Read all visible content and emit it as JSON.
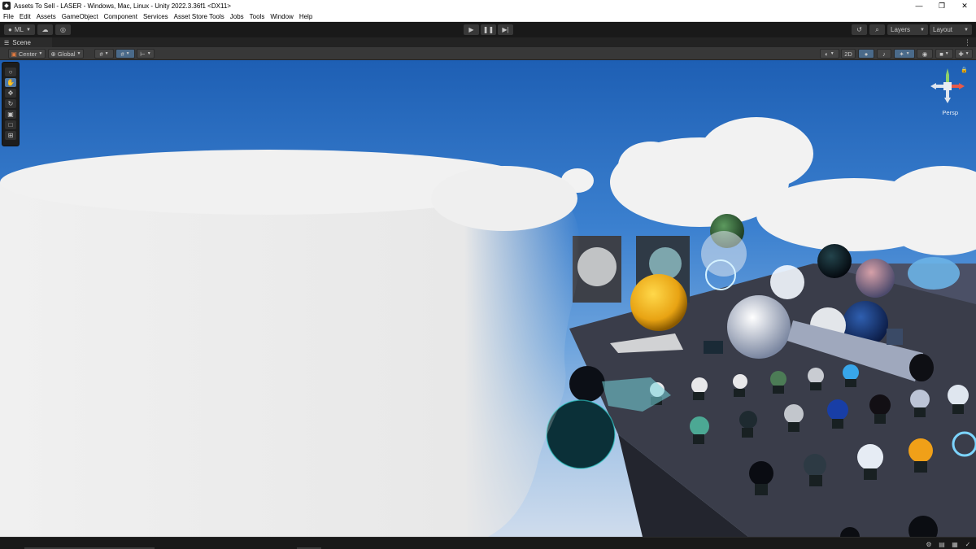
{
  "window": {
    "title": "Assets To Sell - LASER - Windows, Mac, Linux - Unity 2022.3.36f1 <DX11>",
    "minimize": "—",
    "maximize": "❐",
    "close": "✕"
  },
  "menu": [
    "File",
    "Edit",
    "Assets",
    "GameObject",
    "Component",
    "Services",
    "Asset Store Tools",
    "Jobs",
    "Tools",
    "Window",
    "Help"
  ],
  "toolbar": {
    "account_label": "ML",
    "layers_label": "Layers",
    "layout_label": "Layout"
  },
  "scene_tab": {
    "label": "Scene"
  },
  "scene_toolbar": {
    "pivot_label": "Center",
    "space_label": "Global",
    "mode_2d_label": "2D"
  },
  "gizmo": {
    "projection_label": "Persp"
  },
  "colors": {
    "editor_bg": "#191919",
    "panel_bg": "#383838",
    "accent": "#4f7aa8",
    "sky_top": "#1e5fb4",
    "cloud": "#eeeeee"
  }
}
